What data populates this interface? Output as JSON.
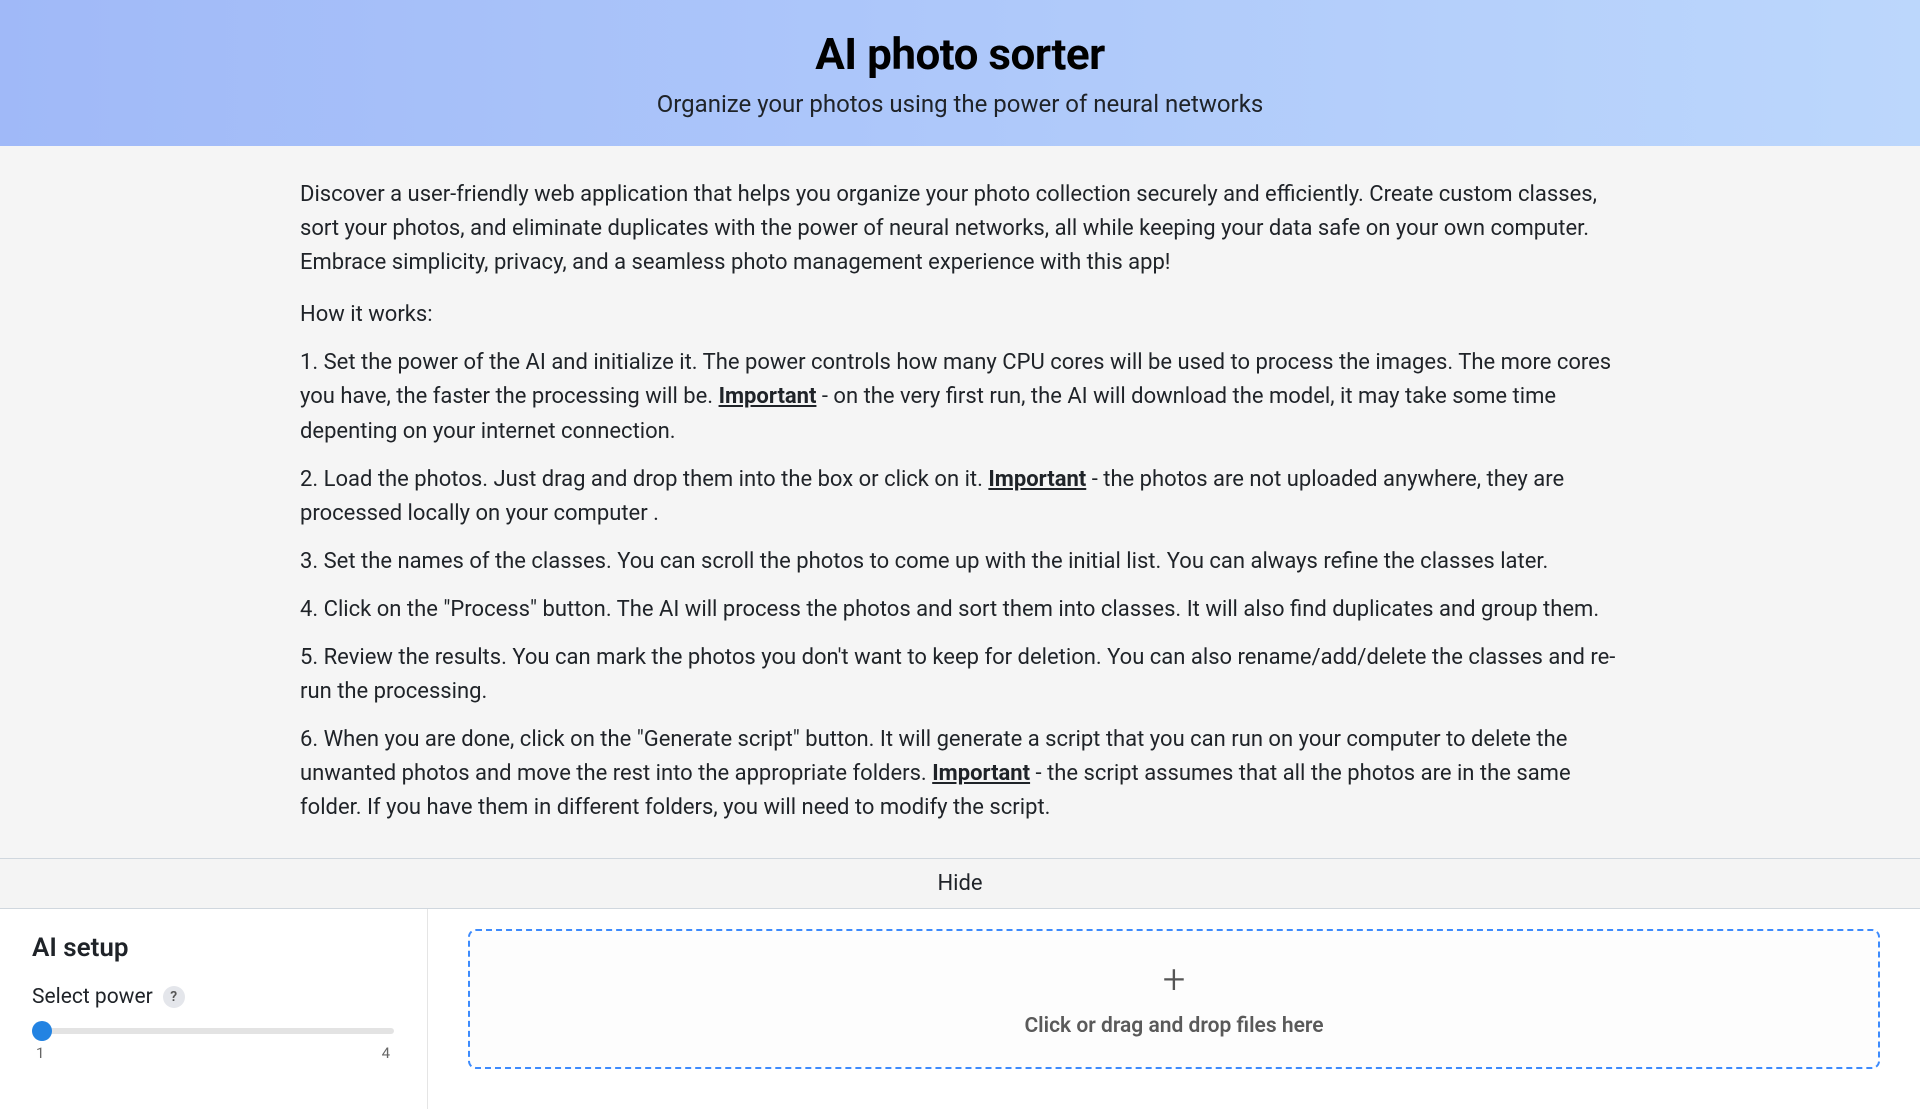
{
  "hero": {
    "title": "AI photo sorter",
    "subtitle": "Organize your photos using the power of neural networks"
  },
  "intro": "Discover a user-friendly web application that helps you organize your photo collection securely and efficiently. Create custom classes, sort your photos, and eliminate duplicates with the power of neural networks, all while keeping your data safe on your own computer. Embrace simplicity, privacy, and a seamless photo management experience with this app!",
  "how_label": "How it works:",
  "steps": {
    "s1a": "1. Set the power of the AI and initialize it. The power controls how many CPU cores will be used to process the images. The more cores you have, the faster the processing will be. ",
    "s1_imp": "Important",
    "s1b": " - on the very first run, the AI will download the model, it may take some time depenting on your internet connection.",
    "s2a": "2. Load the photos. Just drag and drop them into the box or click on it. ",
    "s2_imp": "Important",
    "s2b": " - the photos are not uploaded anywhere, they are processed locally on your computer .",
    "s3": "3. Set the names of the classes. You can scroll the photos to come up with the initial list. You can always refine the classes later.",
    "s4": "4. Click on the \"Process\" button. The AI will process the photos and sort them into classes. It will also find duplicates and group them.",
    "s5": "5. Review the results. You can mark the photos you don't want to keep for deletion. You can also rename/add/delete the classes and re-run the processing.",
    "s6a": "6. When you are done, click on the \"Generate script\" button. It will generate a script that you can run on your computer to delete the unwanted photos and move the rest into the appropriate folders. ",
    "s6_imp": "Important",
    "s6b": " - the script assumes that all the photos are in the same folder. If you have them in different folders, you will need to modify the script."
  },
  "hide_label": "Hide",
  "setup": {
    "heading": "AI setup",
    "power_label": "Select power",
    "qmark": "?",
    "slider_min": "1",
    "slider_max": "4",
    "slider_value": "1"
  },
  "dropzone": {
    "text": "Click or drag and drop files here"
  }
}
